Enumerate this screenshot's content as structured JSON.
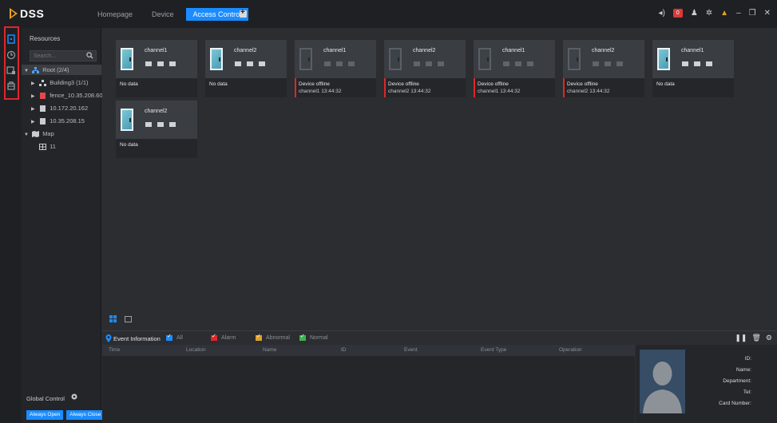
{
  "app": {
    "logo_text": "DSS",
    "tabs": [
      {
        "label": "Homepage",
        "active": false
      },
      {
        "label": "Device",
        "active": false
      },
      {
        "label": "Access Control",
        "active": true
      }
    ],
    "alarm_count": "0"
  },
  "resources": {
    "title": "Resources",
    "search_placeholder": "Search...",
    "tree": [
      {
        "label": "Root (2/4)",
        "icon": "root-icon",
        "expanded": true
      },
      {
        "label": "Building3 (1/1)",
        "icon": "building-icon"
      },
      {
        "label": "fence_10.35.208.60",
        "icon": "device-red-icon"
      },
      {
        "label": "10.172.20.162",
        "icon": "device-icon"
      },
      {
        "label": "10.35.208.15",
        "icon": "device-icon"
      },
      {
        "label": "Map",
        "icon": "map-icon",
        "expanded": true
      },
      {
        "label": "11",
        "icon": "map-item-icon"
      }
    ]
  },
  "global_control": {
    "label": "Global Control",
    "always_open": "Always Open",
    "always_close": "Always Close"
  },
  "channels": [
    {
      "name": "channel1",
      "online": true,
      "status": "No data",
      "time": ""
    },
    {
      "name": "channel2",
      "online": true,
      "status": "No data",
      "time": ""
    },
    {
      "name": "channel1",
      "online": false,
      "status": "Device offline",
      "time": "channel1 13:44:32"
    },
    {
      "name": "channel2",
      "online": false,
      "status": "Device offline",
      "time": "channel2 13:44:32"
    },
    {
      "name": "channel1",
      "online": false,
      "status": "Device offline",
      "time": "channel1 13:44:32"
    },
    {
      "name": "channel2",
      "online": false,
      "status": "Device offline",
      "time": "channel2 13:44:32"
    },
    {
      "name": "channel1",
      "online": true,
      "status": "No data",
      "time": ""
    },
    {
      "name": "channel2",
      "online": true,
      "status": "No data",
      "time": ""
    }
  ],
  "events": {
    "title": "Event Information",
    "filters": [
      {
        "label": "All",
        "color": "#1a8cff"
      },
      {
        "label": "Alarm",
        "color": "#e0262a"
      },
      {
        "label": "Abnormal",
        "color": "#e0a12b"
      },
      {
        "label": "Normal",
        "color": "#3fb34f"
      }
    ],
    "columns": [
      "Time",
      "Location",
      "Name",
      "ID",
      "Event",
      "Event Type",
      "Operation"
    ]
  },
  "person_detail": {
    "id": "ID:",
    "name": "Name:",
    "department": "Department:",
    "tel": "Tel:",
    "card_number": "Card Number:"
  }
}
